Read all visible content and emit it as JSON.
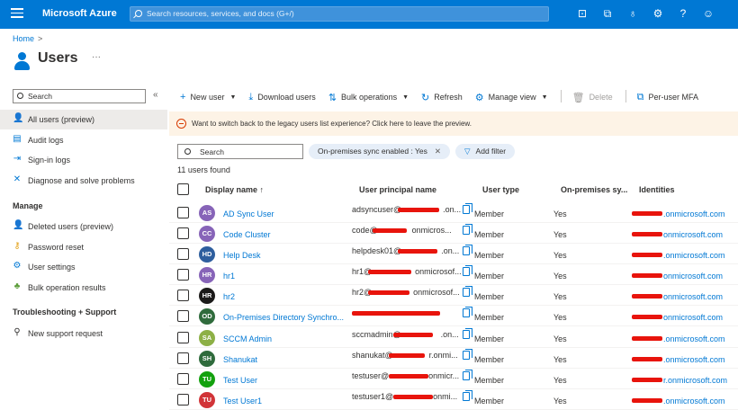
{
  "topbar": {
    "brand": "Microsoft Azure",
    "search_placeholder": "Search resources, services, and docs (G+/)",
    "icons": [
      "cloud-shell-icon",
      "directory-filter-icon",
      "notifications-icon",
      "settings-icon",
      "help-icon",
      "feedback-icon"
    ]
  },
  "breadcrumb": {
    "home": "Home",
    "separator": ">"
  },
  "page": {
    "title": "Users",
    "more": "···"
  },
  "sidebar": {
    "search_placeholder": "Search",
    "collapse": "«",
    "items": [
      {
        "label": "All users (preview)",
        "icon": "user-icon",
        "active": true
      },
      {
        "label": "Audit logs",
        "icon": "audit-log-icon"
      },
      {
        "label": "Sign-in logs",
        "icon": "sign-in-icon"
      },
      {
        "label": "Diagnose and solve problems",
        "icon": "wrench-icon"
      }
    ],
    "manage_heading": "Manage",
    "manage_items": [
      {
        "label": "Deleted users (preview)",
        "icon": "deleted-user-icon"
      },
      {
        "label": "Password reset",
        "icon": "key-icon"
      },
      {
        "label": "User settings",
        "icon": "user-settings-icon"
      },
      {
        "label": "Bulk operation results",
        "icon": "bulk-results-icon"
      }
    ],
    "support_heading": "Troubleshooting + Support",
    "support_items": [
      {
        "label": "New support request",
        "icon": "support-person-icon"
      }
    ]
  },
  "toolbar": {
    "new_user": "New user",
    "download_users": "Download users",
    "bulk_operations": "Bulk operations",
    "refresh": "Refresh",
    "manage_view": "Manage view",
    "delete": "Delete",
    "per_user_mfa": "Per-user MFA"
  },
  "banner": {
    "text": "Want to switch back to the legacy users list experience? Click here to leave the preview."
  },
  "filters": {
    "search_placeholder": "Search",
    "active_filter": "On-premises sync enabled : Yes",
    "add_filter": "Add filter",
    "count": "11 users found"
  },
  "table": {
    "columns": {
      "display_name": "Display name ↑",
      "upn": "User principal name",
      "user_type": "User type",
      "sync": "On-premises sy...",
      "identities": "Identities"
    },
    "rows": [
      {
        "initials": "AS",
        "color": "#8764b8",
        "name": "AD Sync User",
        "upn_pre": "adsyncuser@",
        "upn_post": ".on...",
        "type": "Member",
        "sync": "Yes",
        "ident": ".onmicrosoft.com"
      },
      {
        "initials": "CC",
        "color": "#8764b8",
        "name": "Code Cluster",
        "upn_pre": "code@",
        "upn_post": "onmicros...",
        "type": "Member",
        "sync": "Yes",
        "ident": "onmicrosoft.com"
      },
      {
        "initials": "HD",
        "color": "#2e5e9e",
        "name": "Help Desk",
        "upn_pre": "helpdesk01@",
        "upn_post": ".on...",
        "type": "Member",
        "sync": "Yes",
        "ident": ".onmicrosoft.com"
      },
      {
        "initials": "HR",
        "color": "#8764b8",
        "name": "hr1",
        "upn_pre": "hr1@",
        "upn_post": "onmicrosof...",
        "type": "Member",
        "sync": "Yes",
        "ident": "onmicrosoft.com"
      },
      {
        "initials": "HR",
        "color": "#1b1a19",
        "name": "hr2",
        "upn_pre": "hr2@",
        "upn_post": "onmicrosof...",
        "type": "Member",
        "sync": "Yes",
        "ident": "onmicrosoft.com"
      },
      {
        "initials": "OD",
        "color": "#2f6b3c",
        "name": "On-Premises Directory Synchro...",
        "upn_pre": "",
        "upn_post": "",
        "type": "Member",
        "sync": "Yes",
        "ident": "onmicrosoft.com"
      },
      {
        "initials": "SA",
        "color": "#8db046",
        "name": "SCCM Admin",
        "upn_pre": "sccmadmin@",
        "upn_post": ".on...",
        "type": "Member",
        "sync": "Yes",
        "ident": ".onmicrosoft.com"
      },
      {
        "initials": "SH",
        "color": "#2f6b3c",
        "name": "Shanukat",
        "upn_pre": "shanukat@",
        "upn_post": "r.onmi...",
        "type": "Member",
        "sync": "Yes",
        "ident": ".onmicrosoft.com"
      },
      {
        "initials": "TU",
        "color": "#13a10e",
        "name": "Test User",
        "upn_pre": "testuser@",
        "upn_post": "onmicr...",
        "type": "Member",
        "sync": "Yes",
        "ident": "r.onmicrosoft.com"
      },
      {
        "initials": "TU",
        "color": "#d13438",
        "name": "Test User1",
        "upn_pre": "testuser1@",
        "upn_post": "onmi...",
        "type": "Member",
        "sync": "Yes",
        "ident": ".onmicrosoft.com"
      }
    ]
  },
  "colors": {
    "azure_blue": "#0078d4",
    "banner_bg": "#fdf3e6",
    "redaction": "#e8140c"
  }
}
